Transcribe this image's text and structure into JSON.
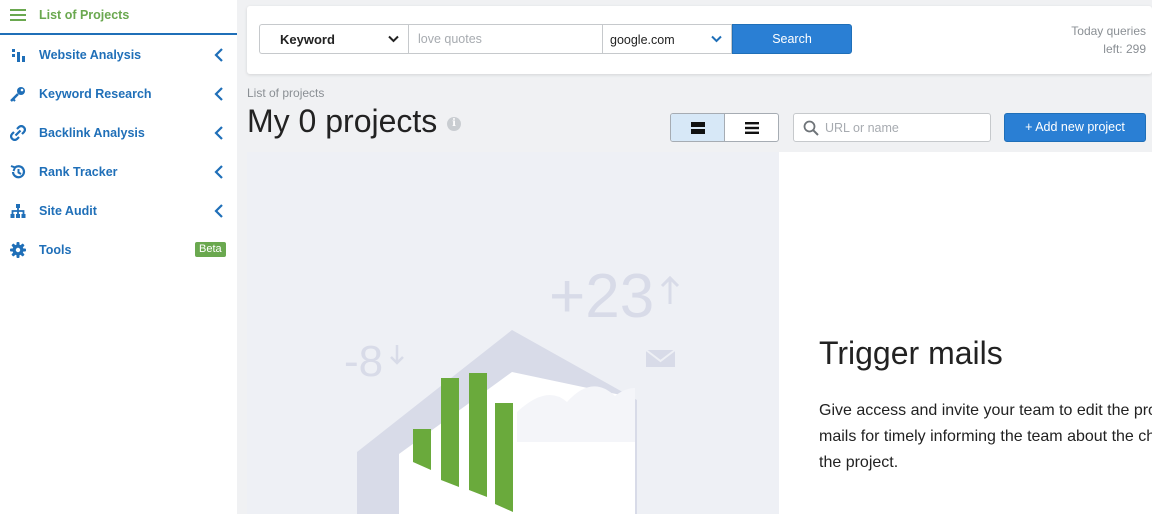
{
  "sidebar": {
    "items": [
      {
        "label": "List of Projects",
        "icon": "hamburger-menu-icon"
      },
      {
        "label": "Website Analysis",
        "icon": "bar-chart-icon"
      },
      {
        "label": "Keyword Research",
        "icon": "key-icon"
      },
      {
        "label": "Backlink Analysis",
        "icon": "link-icon"
      },
      {
        "label": "Rank Tracker",
        "icon": "history-icon"
      },
      {
        "label": "Site Audit",
        "icon": "sitemap-icon"
      },
      {
        "label": "Tools",
        "icon": "gear-icon"
      }
    ],
    "beta_badge": "Beta"
  },
  "search": {
    "mode_selected": "Keyword",
    "query_placeholder": "love quotes",
    "domain_selected": "google.com",
    "search_label": "Search",
    "quota_line1": "Today queries",
    "quota_line2": "left: 299"
  },
  "header": {
    "breadcrumb": "List of projects",
    "title": "My 0 projects",
    "info_glyph": "i",
    "url_placeholder": "URL or name",
    "add_project_label": "+ Add new project"
  },
  "illustration": {
    "up_value": "+23",
    "down_value": "-8"
  },
  "promo": {
    "title": "Trigger mails",
    "text": "Give access and invite your team to edit the project. Set up mails for timely informing the team about the changes of the project."
  },
  "colors": {
    "accent_blue": "#2a7fd4",
    "link_blue": "#1f6fb8",
    "brand_green": "#6aa84f",
    "illustration_bg": "#eef0f5"
  }
}
